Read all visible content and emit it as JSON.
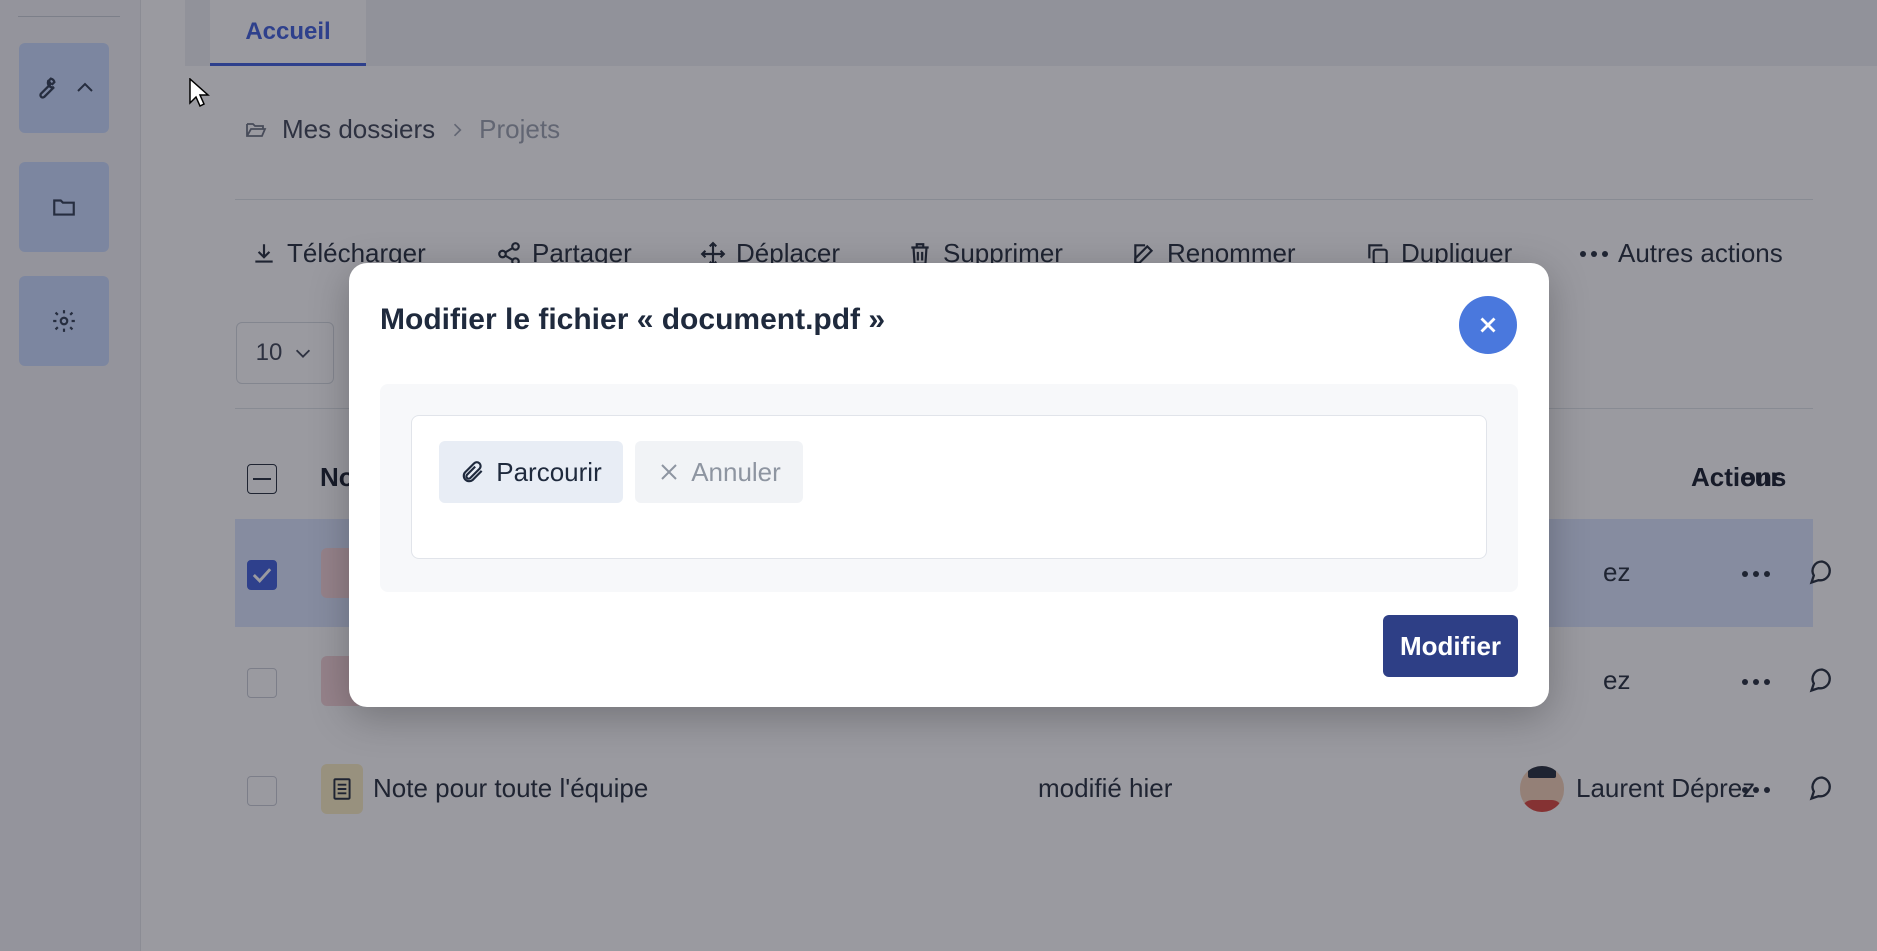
{
  "tabs": [
    {
      "label": "Accueil",
      "active": true
    }
  ],
  "breadcrumb": {
    "root": "Mes dossiers",
    "current": "Projets"
  },
  "toolbar": {
    "download": "Télécharger",
    "share": "Partager",
    "move": "Déplacer",
    "delete": "Supprimer",
    "rename": "Renommer",
    "duplicate": "Dupliquer",
    "more": "Autres actions"
  },
  "per_page": "10",
  "table": {
    "headers": {
      "name": "No",
      "owner": "eur",
      "actions": "Actions"
    },
    "rows": [
      {
        "name": "",
        "modified": "",
        "owner": "ez",
        "checked": true,
        "type": "pdf"
      },
      {
        "name": "",
        "modified": "",
        "owner": "ez",
        "checked": false,
        "type": "pdf"
      },
      {
        "name": "Note pour toute l'équipe",
        "modified": "modifié hier",
        "owner": "Laurent Déprez",
        "checked": false,
        "type": "note"
      }
    ]
  },
  "modal": {
    "title": "Modifier le fichier « document.pdf »",
    "browse": "Parcourir",
    "cancel": "Annuler",
    "submit": "Modifier"
  },
  "colors": {
    "accent": "#3b5bdb",
    "close": "#4a78dd",
    "submit": "#2e3f86",
    "rail_button": "#c9dbff"
  }
}
